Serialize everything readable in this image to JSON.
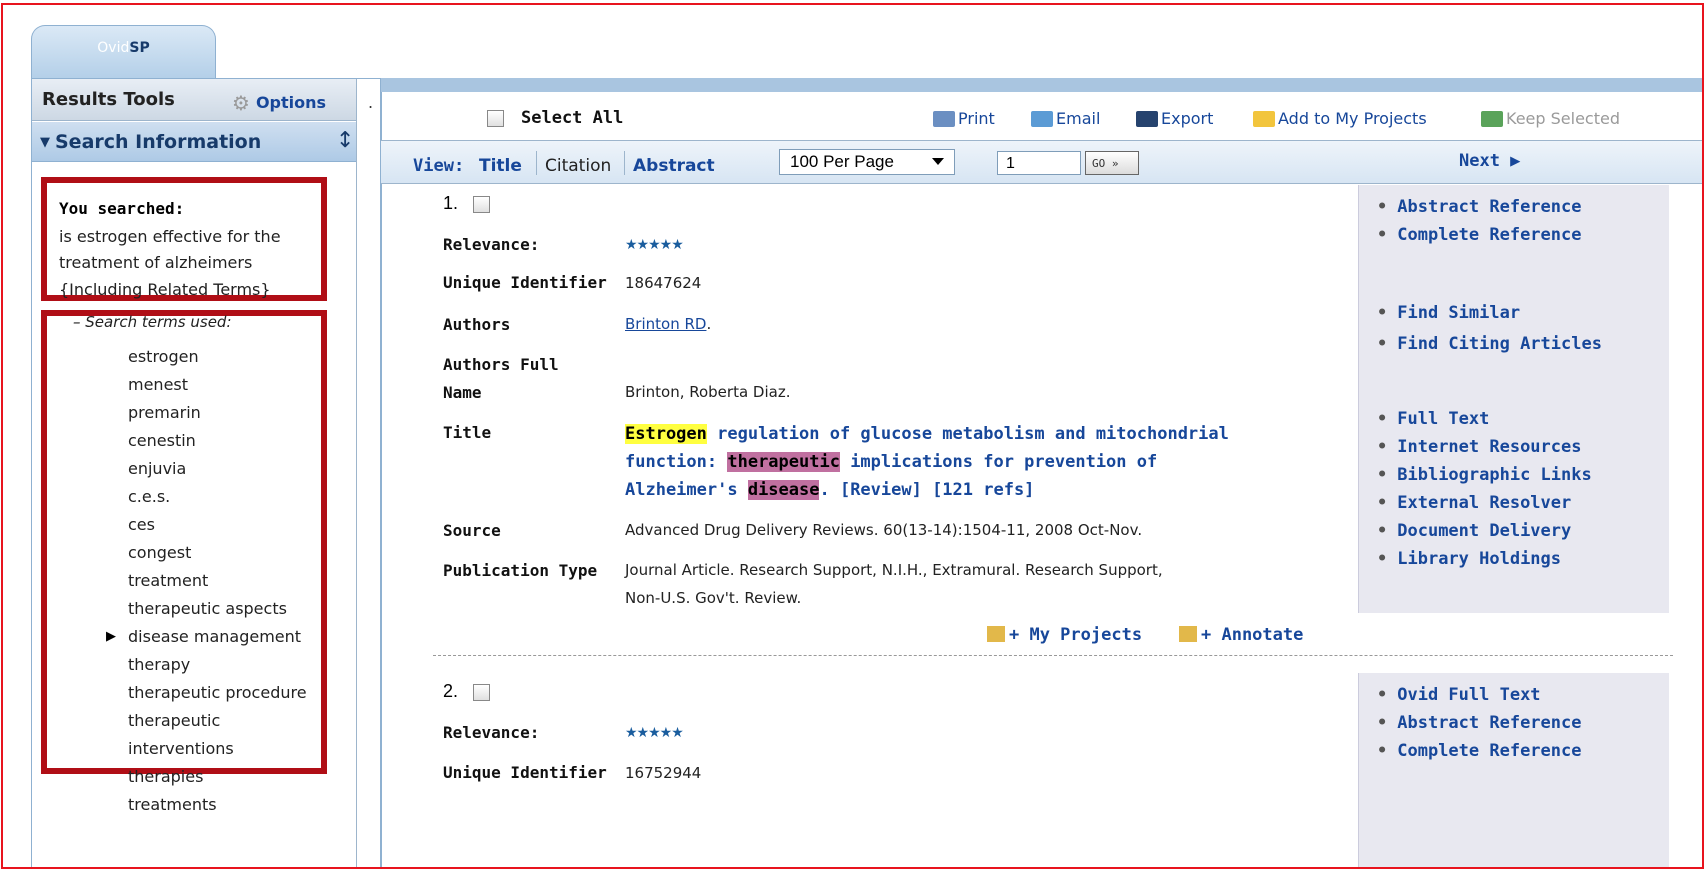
{
  "brand": {
    "ovid": "Ovid",
    "sp": "SP"
  },
  "sidebar": {
    "tools_title": "Results Tools",
    "options_label": "Options",
    "section_title": "Search Information",
    "you_searched_label": "You searched:",
    "query_lines": [
      "is estrogen effective for the",
      "treatment of alzheimers",
      "{Including Related Terms}"
    ],
    "terms_heading": "–  Search terms used:",
    "terms": [
      "estrogen",
      "menest",
      "premarin",
      "cenestin",
      "enjuvia",
      "c.e.s.",
      "ces",
      "congest",
      "treatment",
      "therapeutic aspects",
      "disease management",
      "therapy",
      "therapeutic procedure",
      "therapeutic",
      "interventions",
      "therapies",
      "treatments"
    ]
  },
  "toolbar": {
    "select_all": "Select All",
    "print": "Print",
    "email": "Email",
    "export": "Export",
    "add_to_projects": "Add to My Projects",
    "keep_selected": "Keep Selected"
  },
  "view": {
    "label": "View:",
    "title_opt": "Title",
    "citation_opt": "Citation",
    "abstract_opt": "Abstract",
    "per_page": "100 Per Page",
    "page_value": "1",
    "go": "GO »",
    "next": "Next ▶"
  },
  "labels": {
    "relevance": "Relevance:",
    "unique_id": "Unique Identifier",
    "authors": "Authors",
    "authors_full_1": "Authors Full",
    "authors_full_2": "Name",
    "title": "Title",
    "source": "Source",
    "pub_type": "Publication Type",
    "my_projects": "+ My Projects",
    "annotate": "+ Annotate"
  },
  "records": [
    {
      "number": "1.",
      "stars": "★★★★★",
      "unique_id": "18647624",
      "authors": "Brinton RD",
      "authors_full": "Brinton, Roberta Diaz.",
      "title_parts": {
        "w1": "Estrogen",
        "t1": " regulation of glucose metabolism and mitochondrial",
        "t2a": "function: ",
        "w2": "therapeutic",
        "t2b": " implications for prevention of",
        "t3a": "Alzheimer's ",
        "w3": "disease",
        "t3b": ". [Review] [121 refs]"
      },
      "source": "Advanced Drug Delivery Reviews. 60(13-14):1504-11, 2008 Oct-Nov.",
      "pub_type_1": "Journal Article. Research Support, N.I.H., Extramural. Research Support,",
      "pub_type_2": "Non-U.S. Gov't. Review.",
      "links": [
        "Abstract Reference",
        "Complete Reference",
        "Find Similar",
        "Find Citing Articles",
        "Full Text",
        "Internet Resources",
        "Bibliographic Links",
        "External Resolver",
        "Document Delivery",
        "Library Holdings"
      ]
    },
    {
      "number": "2.",
      "stars": "★★★★★",
      "unique_id": "16752944",
      "links": [
        "Ovid Full Text",
        "Abstract Reference",
        "Complete Reference"
      ]
    }
  ],
  "colors": {
    "accent": "#17479a",
    "frame_red": "#e8141e",
    "highlight_box": "#b00e16"
  }
}
